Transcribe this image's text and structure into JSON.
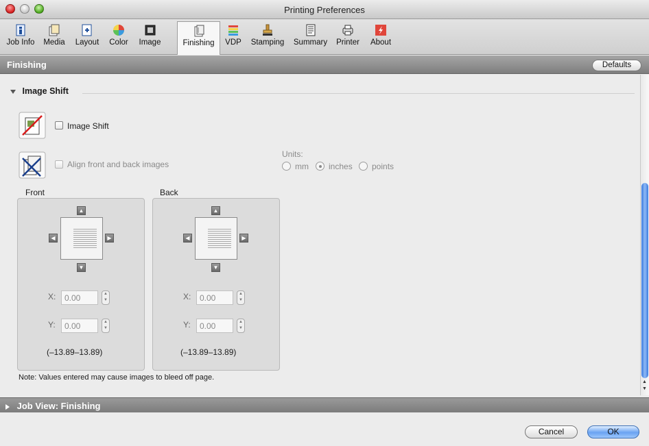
{
  "window": {
    "title": "Printing Preferences"
  },
  "toolbar": {
    "items": [
      {
        "label": "Job Info",
        "icon": "job-info-icon"
      },
      {
        "label": "Media",
        "icon": "media-icon"
      },
      {
        "label": "Layout",
        "icon": "layout-icon"
      },
      {
        "label": "Color",
        "icon": "color-icon"
      },
      {
        "label": "Image",
        "icon": "image-icon"
      },
      {
        "label": "Finishing",
        "icon": "finishing-icon",
        "active": true
      },
      {
        "label": "VDP",
        "icon": "vdp-icon"
      },
      {
        "label": "Stamping",
        "icon": "stamping-icon"
      },
      {
        "label": "Summary",
        "icon": "summary-icon"
      },
      {
        "label": "Printer",
        "icon": "printer-icon"
      },
      {
        "label": "About",
        "icon": "about-icon"
      }
    ]
  },
  "section": {
    "title": "Finishing",
    "defaults_label": "Defaults"
  },
  "image_shift": {
    "group_title": "Image Shift",
    "enable_label": "Image Shift",
    "enable_checked": false,
    "align_label": "Align front and back images",
    "align_checked": false,
    "units": {
      "label": "Units:",
      "options": [
        "mm",
        "inches",
        "points"
      ],
      "selected": "inches"
    },
    "front": {
      "label": "Front",
      "x_label": "X:",
      "x_value": "0.00",
      "y_label": "Y:",
      "y_value": "0.00",
      "range": "(–13.89–13.89)"
    },
    "back": {
      "label": "Back",
      "x_label": "X:",
      "x_value": "0.00",
      "y_label": "Y:",
      "y_value": "0.00",
      "range": "(–13.89–13.89)"
    },
    "note": "Note: Values entered may cause images to bleed off page."
  },
  "job_view": {
    "title": "Job View: Finishing"
  },
  "buttons": {
    "cancel": "Cancel",
    "ok": "OK"
  },
  "colors": {
    "accent": "#3a7be0",
    "section_bar": "#8e8e8e"
  }
}
